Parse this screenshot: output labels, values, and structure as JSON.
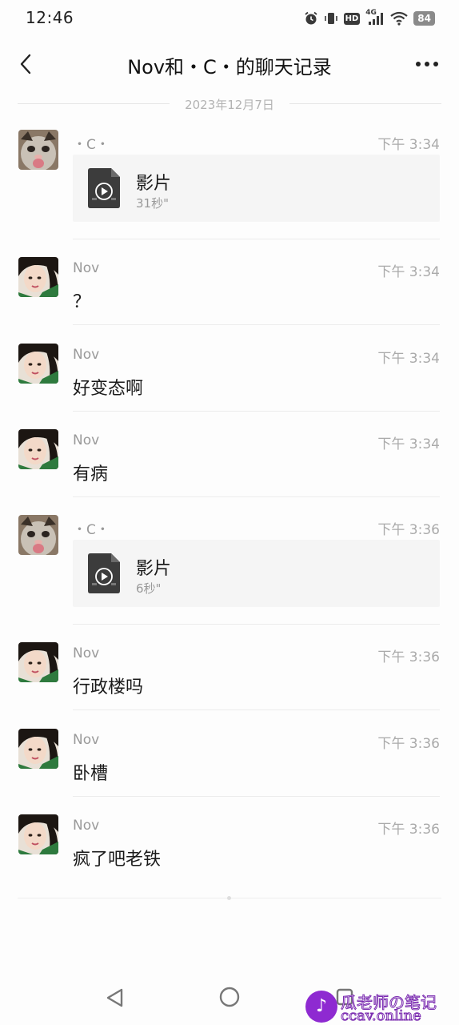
{
  "status_bar": {
    "time": "12:46",
    "network": "4G",
    "hd": "HD",
    "battery": "84"
  },
  "header": {
    "title": "Nov和・C・的聊天记录"
  },
  "date_divider": "2023年12月7日",
  "messages": [
    {
      "sender": "・C・",
      "time": "下午 3:34",
      "type": "video",
      "video_title": "影片",
      "duration": "31秒\""
    },
    {
      "sender": "Nov",
      "time": "下午 3:34",
      "type": "text",
      "text": "？"
    },
    {
      "sender": "Nov",
      "time": "下午 3:34",
      "type": "text",
      "text": "好变态啊"
    },
    {
      "sender": "Nov",
      "time": "下午 3:34",
      "type": "text",
      "text": "有病"
    },
    {
      "sender": "・C・",
      "time": "下午 3:36",
      "type": "video",
      "video_title": "影片",
      "duration": "6秒\""
    },
    {
      "sender": "Nov",
      "time": "下午 3:36",
      "type": "text",
      "text": "行政楼吗"
    },
    {
      "sender": "Nov",
      "time": "下午 3:36",
      "type": "text",
      "text": "卧槽"
    },
    {
      "sender": "Nov",
      "time": "下午 3:36",
      "type": "text",
      "text": "疯了吧老铁"
    }
  ],
  "watermark": {
    "line1": "瓜老师の笔记",
    "line2": "ccav.online"
  },
  "colors": {
    "card_bg": "#f5f5f5",
    "meta_text": "#999999",
    "watermark": "#8e2ad1"
  }
}
